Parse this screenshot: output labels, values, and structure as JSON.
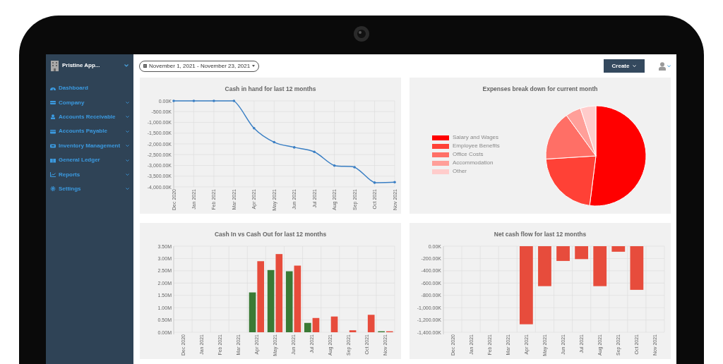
{
  "sidebar": {
    "title": "Pristine App...",
    "items": [
      {
        "label": "Dashboard",
        "expandable": false
      },
      {
        "label": "Company",
        "expandable": true
      },
      {
        "label": "Accounts Receivable",
        "expandable": true
      },
      {
        "label": "Accounts Payable",
        "expandable": true
      },
      {
        "label": "Inventory Management",
        "expandable": true
      },
      {
        "label": "General Ledger",
        "expandable": true
      },
      {
        "label": "Reports",
        "expandable": true
      },
      {
        "label": "Settings",
        "expandable": true
      }
    ]
  },
  "toolbar": {
    "date_range": "November 1, 2021 - November 23, 2021",
    "create_button": "Create"
  },
  "cards": [
    {
      "chart_data": {
        "type": "line",
        "title": "Cash in hand for last 12 months",
        "categories": [
          "Dec 2020",
          "Jan 2021",
          "Feb 2021",
          "Mar 2021",
          "Apr 2021",
          "May 2021",
          "Jun 2021",
          "Jul 2021",
          "Aug 2021",
          "Sep 2021",
          "Oct 2021",
          "Nov 2021"
        ],
        "series": [
          {
            "color": "#3a7fc4",
            "values": [
              0,
              0,
              0,
              0,
              -1270,
              -1920,
              -2160,
              -2370,
              -3010,
              -3080,
              -3800,
              -3780
            ]
          }
        ],
        "ylim": [
          -4000,
          0
        ],
        "grid": true,
        "yticks": [
          {
            "value": 0,
            "label": "0.00K"
          },
          {
            "value": -500,
            "label": "-500.00K"
          },
          {
            "value": -1000,
            "label": "-1,000.00K"
          },
          {
            "value": -1500,
            "label": "-1,500.00K"
          },
          {
            "value": -2000,
            "label": "-2,000.00K"
          },
          {
            "value": -2500,
            "label": "-2,500.00K"
          },
          {
            "value": -3000,
            "label": "-3,000.00K"
          },
          {
            "value": -3500,
            "label": "-3,500.00K"
          },
          {
            "value": -4000,
            "label": "-4,000.00K"
          }
        ]
      }
    },
    {
      "chart_data": {
        "type": "pie",
        "title": "Expenses break down for current month",
        "categories": [
          "Salary and Wages",
          "Employee Benefits",
          "Office Costs",
          "Accommodation",
          "Other"
        ],
        "values": [
          52,
          22,
          16,
          5,
          5
        ],
        "colors": [
          "#ff0000",
          "#ff4136",
          "#ff6f66",
          "#ff9f99",
          "#ffcccb"
        ],
        "legend": true
      }
    },
    {
      "chart_data": {
        "type": "bar",
        "title": "Cash In vs Cash Out for last 12 months",
        "categories": [
          "Dec 2020",
          "Jan 2021",
          "Feb 2021",
          "Mar 2021",
          "Apr 2021",
          "May 2021",
          "Jun 2021",
          "Jul 2021",
          "Aug 2021",
          "Sep 2021",
          "Oct 2021",
          "Nov 2021"
        ],
        "series": [
          {
            "color": "#3a7a35",
            "values": [
              0,
              0,
              0,
              0,
              1.62,
              2.53,
              2.48,
              0.38,
              0,
              0,
              0,
              0.04
            ]
          },
          {
            "color": "#e74c3c",
            "values": [
              0,
              0,
              0,
              0,
              2.89,
              3.18,
              2.71,
              0.58,
              0.64,
              0.08,
              0.71,
              0.04
            ]
          }
        ],
        "ylim": [
          0,
          3.5
        ],
        "grid": true,
        "yticks": [
          {
            "value": 0,
            "label": "0.00M"
          },
          {
            "value": 0.5,
            "label": "0.50M"
          },
          {
            "value": 1,
            "label": "1.00M"
          },
          {
            "value": 1.5,
            "label": "1.50M"
          },
          {
            "value": 2,
            "label": "2.00M"
          },
          {
            "value": 2.5,
            "label": "2.50M"
          },
          {
            "value": 3,
            "label": "3.00M"
          },
          {
            "value": 3.5,
            "label": "3.50M"
          }
        ]
      }
    },
    {
      "chart_data": {
        "type": "bar",
        "title": "Net cash flow for last 12 months",
        "categories": [
          "Dec 2020",
          "Jan 2021",
          "Feb 2021",
          "Mar 2021",
          "Apr 2021",
          "May 2021",
          "Jun 2021",
          "Jul 2021",
          "Aug 2021",
          "Sep 2021",
          "Oct 2021",
          "Nov 2021"
        ],
        "series": [
          {
            "color": "#e74c3c",
            "values": [
              0,
              0,
              0,
              0,
              -1270,
              -650,
              -240,
              -210,
              -650,
              -90,
              -710,
              0
            ]
          }
        ],
        "ylim": [
          -1400,
          0
        ],
        "grid": true,
        "yticks": [
          {
            "value": 0,
            "label": "0.00K"
          },
          {
            "value": -200,
            "label": "-200.00K"
          },
          {
            "value": -400,
            "label": "-400.00K"
          },
          {
            "value": -600,
            "label": "-600.00K"
          },
          {
            "value": -800,
            "label": "-800.00K"
          },
          {
            "value": -1000,
            "label": "-1,000.00K"
          },
          {
            "value": -1200,
            "label": "-1,200.00K"
          },
          {
            "value": -1400,
            "label": "-1,400.00K"
          }
        ]
      }
    }
  ]
}
